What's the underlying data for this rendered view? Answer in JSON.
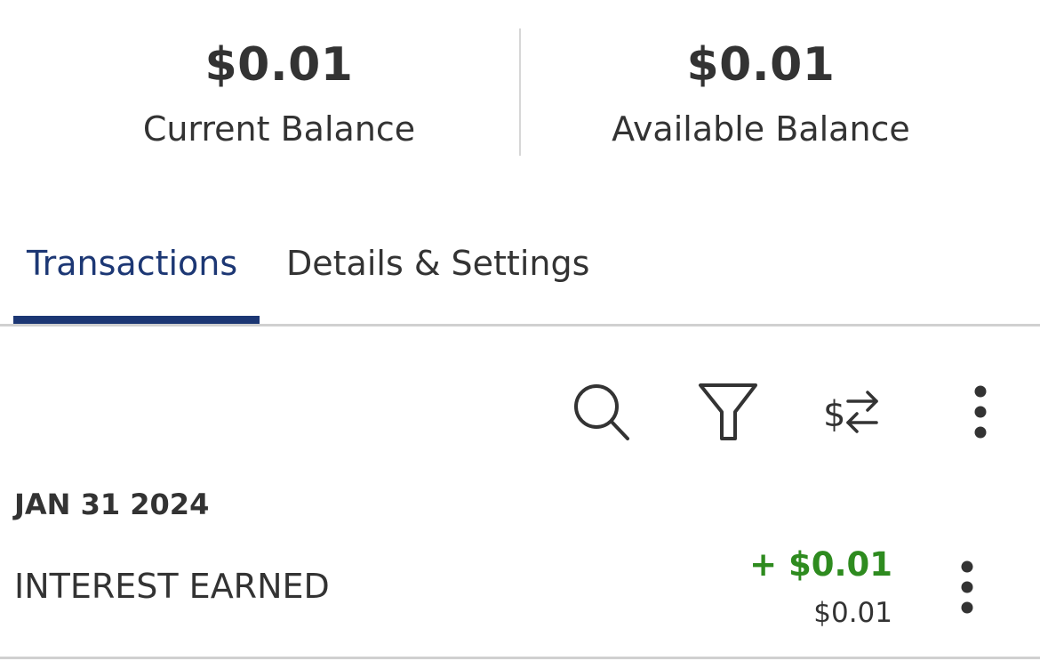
{
  "balances": {
    "current": {
      "amount": "$0.01",
      "label": "Current Balance"
    },
    "available": {
      "amount": "$0.01",
      "label": "Available Balance"
    }
  },
  "tabs": [
    {
      "label": "Transactions",
      "active": true
    },
    {
      "label": "Details & Settings",
      "active": false
    }
  ],
  "toolbar": {
    "icons": [
      "search-icon",
      "filter-icon",
      "dollar-exchange-icon",
      "more-vertical-icon"
    ]
  },
  "transactions": {
    "groups": [
      {
        "date": "JAN 31 2024",
        "items": [
          {
            "description": "INTEREST EARNED",
            "amount": "+ $0.01",
            "running_balance": "$0.01"
          }
        ]
      }
    ]
  },
  "colors": {
    "accent": "#1c3774",
    "credit": "#2e8b1f",
    "text": "#333333",
    "divider": "#d0d0d0"
  }
}
